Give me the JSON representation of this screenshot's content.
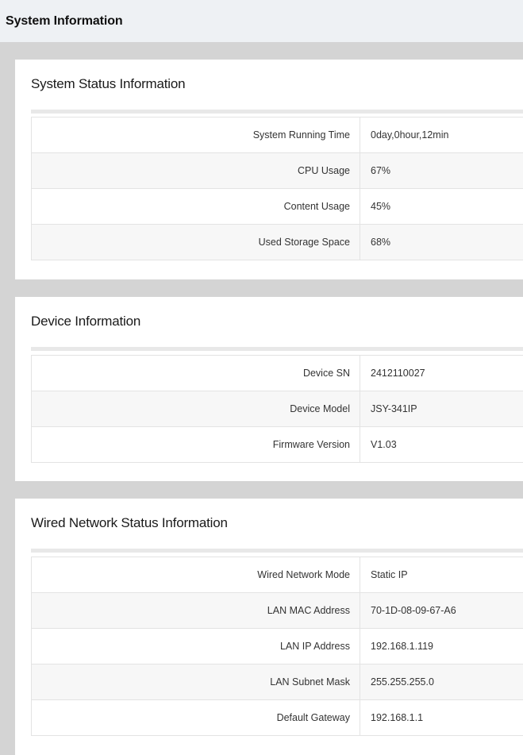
{
  "page": {
    "title": "System Information"
  },
  "system_status": {
    "title": "System Status Information",
    "rows": [
      {
        "label": "System Running Time",
        "value": "0day,0hour,12min"
      },
      {
        "label": "CPU Usage",
        "value": "67%"
      },
      {
        "label": "Content Usage",
        "value": "45%"
      },
      {
        "label": "Used Storage Space",
        "value": "68%"
      }
    ]
  },
  "device_info": {
    "title": "Device Information",
    "rows": [
      {
        "label": "Device SN",
        "value": "2412110027"
      },
      {
        "label": "Device Model",
        "value": "JSY-341IP"
      },
      {
        "label": "Firmware Version",
        "value": "V1.03"
      }
    ]
  },
  "wired_network": {
    "title": "Wired Network Status Information",
    "rows": [
      {
        "label": "Wired Network Mode",
        "value": "Static IP"
      },
      {
        "label": "LAN MAC Address",
        "value": "70-1D-08-09-67-A6"
      },
      {
        "label": "LAN IP Address",
        "value": "192.168.1.119"
      },
      {
        "label": "LAN Subnet Mask",
        "value": "255.255.255.0"
      },
      {
        "label": "Default Gateway",
        "value": "192.168.1.1"
      }
    ]
  }
}
